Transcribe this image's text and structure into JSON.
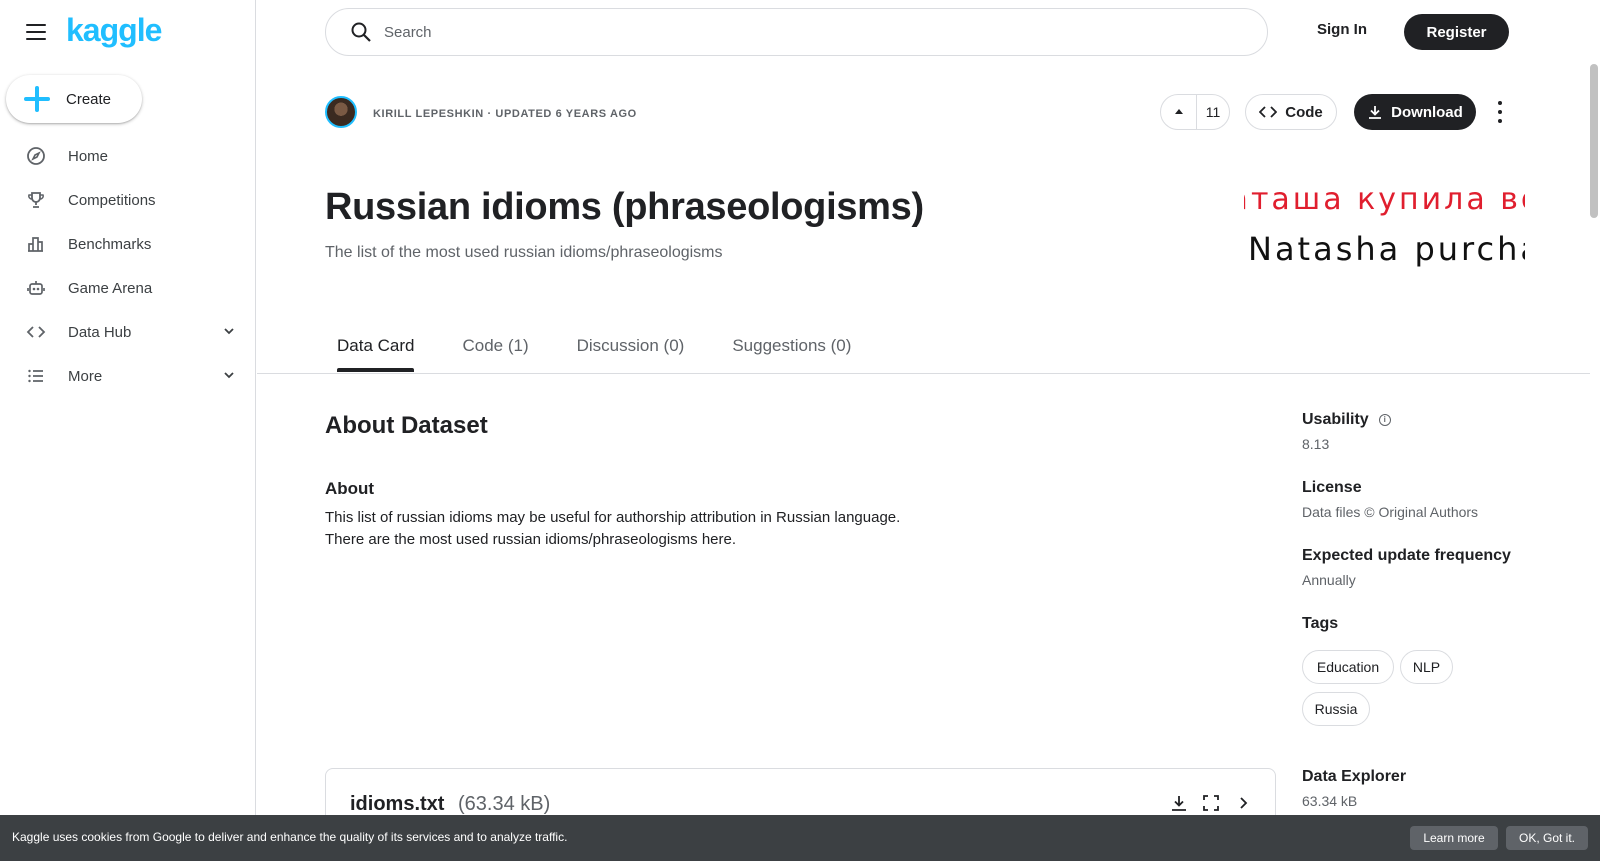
{
  "app": {
    "logo_text": "kaggle",
    "brand_color": "#20beff"
  },
  "sidebar": {
    "create_label": "Create",
    "items": [
      {
        "label": "Home",
        "icon": "compass-icon"
      },
      {
        "label": "Competitions",
        "icon": "trophy-icon"
      },
      {
        "label": "Benchmarks",
        "icon": "bar-chart-icon"
      },
      {
        "label": "Game Arena",
        "icon": "robot-icon"
      },
      {
        "label": "Data Hub",
        "icon": "code-icon",
        "expandable": true
      },
      {
        "label": "More",
        "icon": "list-icon",
        "expandable": true
      }
    ]
  },
  "header": {
    "search_placeholder": "Search",
    "sign_in": "Sign In",
    "register": "Register"
  },
  "dataset": {
    "byline": "KIRILL LEPESHKIN · UPDATED 6 YEARS AGO",
    "upvotes": "11",
    "code_label": "Code",
    "download_label": "Download",
    "title": "Russian idioms (phraseologisms)",
    "subtitle": "The list of the most used russian idioms/phraseologisms",
    "banner_ru": "Наташа купила во",
    "banner_en": "Natasha purchased v"
  },
  "tabs": [
    "Data Card",
    "Code (1)",
    "Discussion (0)",
    "Suggestions (0)"
  ],
  "about": {
    "heading": "About Dataset",
    "subheading": "About",
    "line1": "This list of russian idioms may be useful for authorship attribution in Russian language.",
    "line2": "There are the most used russian idioms/phraseologisms here."
  },
  "meta": {
    "usability_label": "Usability",
    "usability_value": "8.13",
    "license_label": "License",
    "license_value": "Data files © Original Authors",
    "frequency_label": "Expected update frequency",
    "frequency_value": "Annually",
    "tags_label": "Tags",
    "tags": [
      "Education",
      "NLP",
      "Russia"
    ],
    "explorer_label": "Data Explorer",
    "explorer_value": "63.34 kB"
  },
  "file": {
    "name": "idioms.txt",
    "size": "(63.34 kB)"
  },
  "cookie": {
    "text": "Kaggle uses cookies from Google to deliver and enhance the quality of its services and to analyze traffic.",
    "learn_more": "Learn more",
    "ok": "OK, Got it."
  }
}
